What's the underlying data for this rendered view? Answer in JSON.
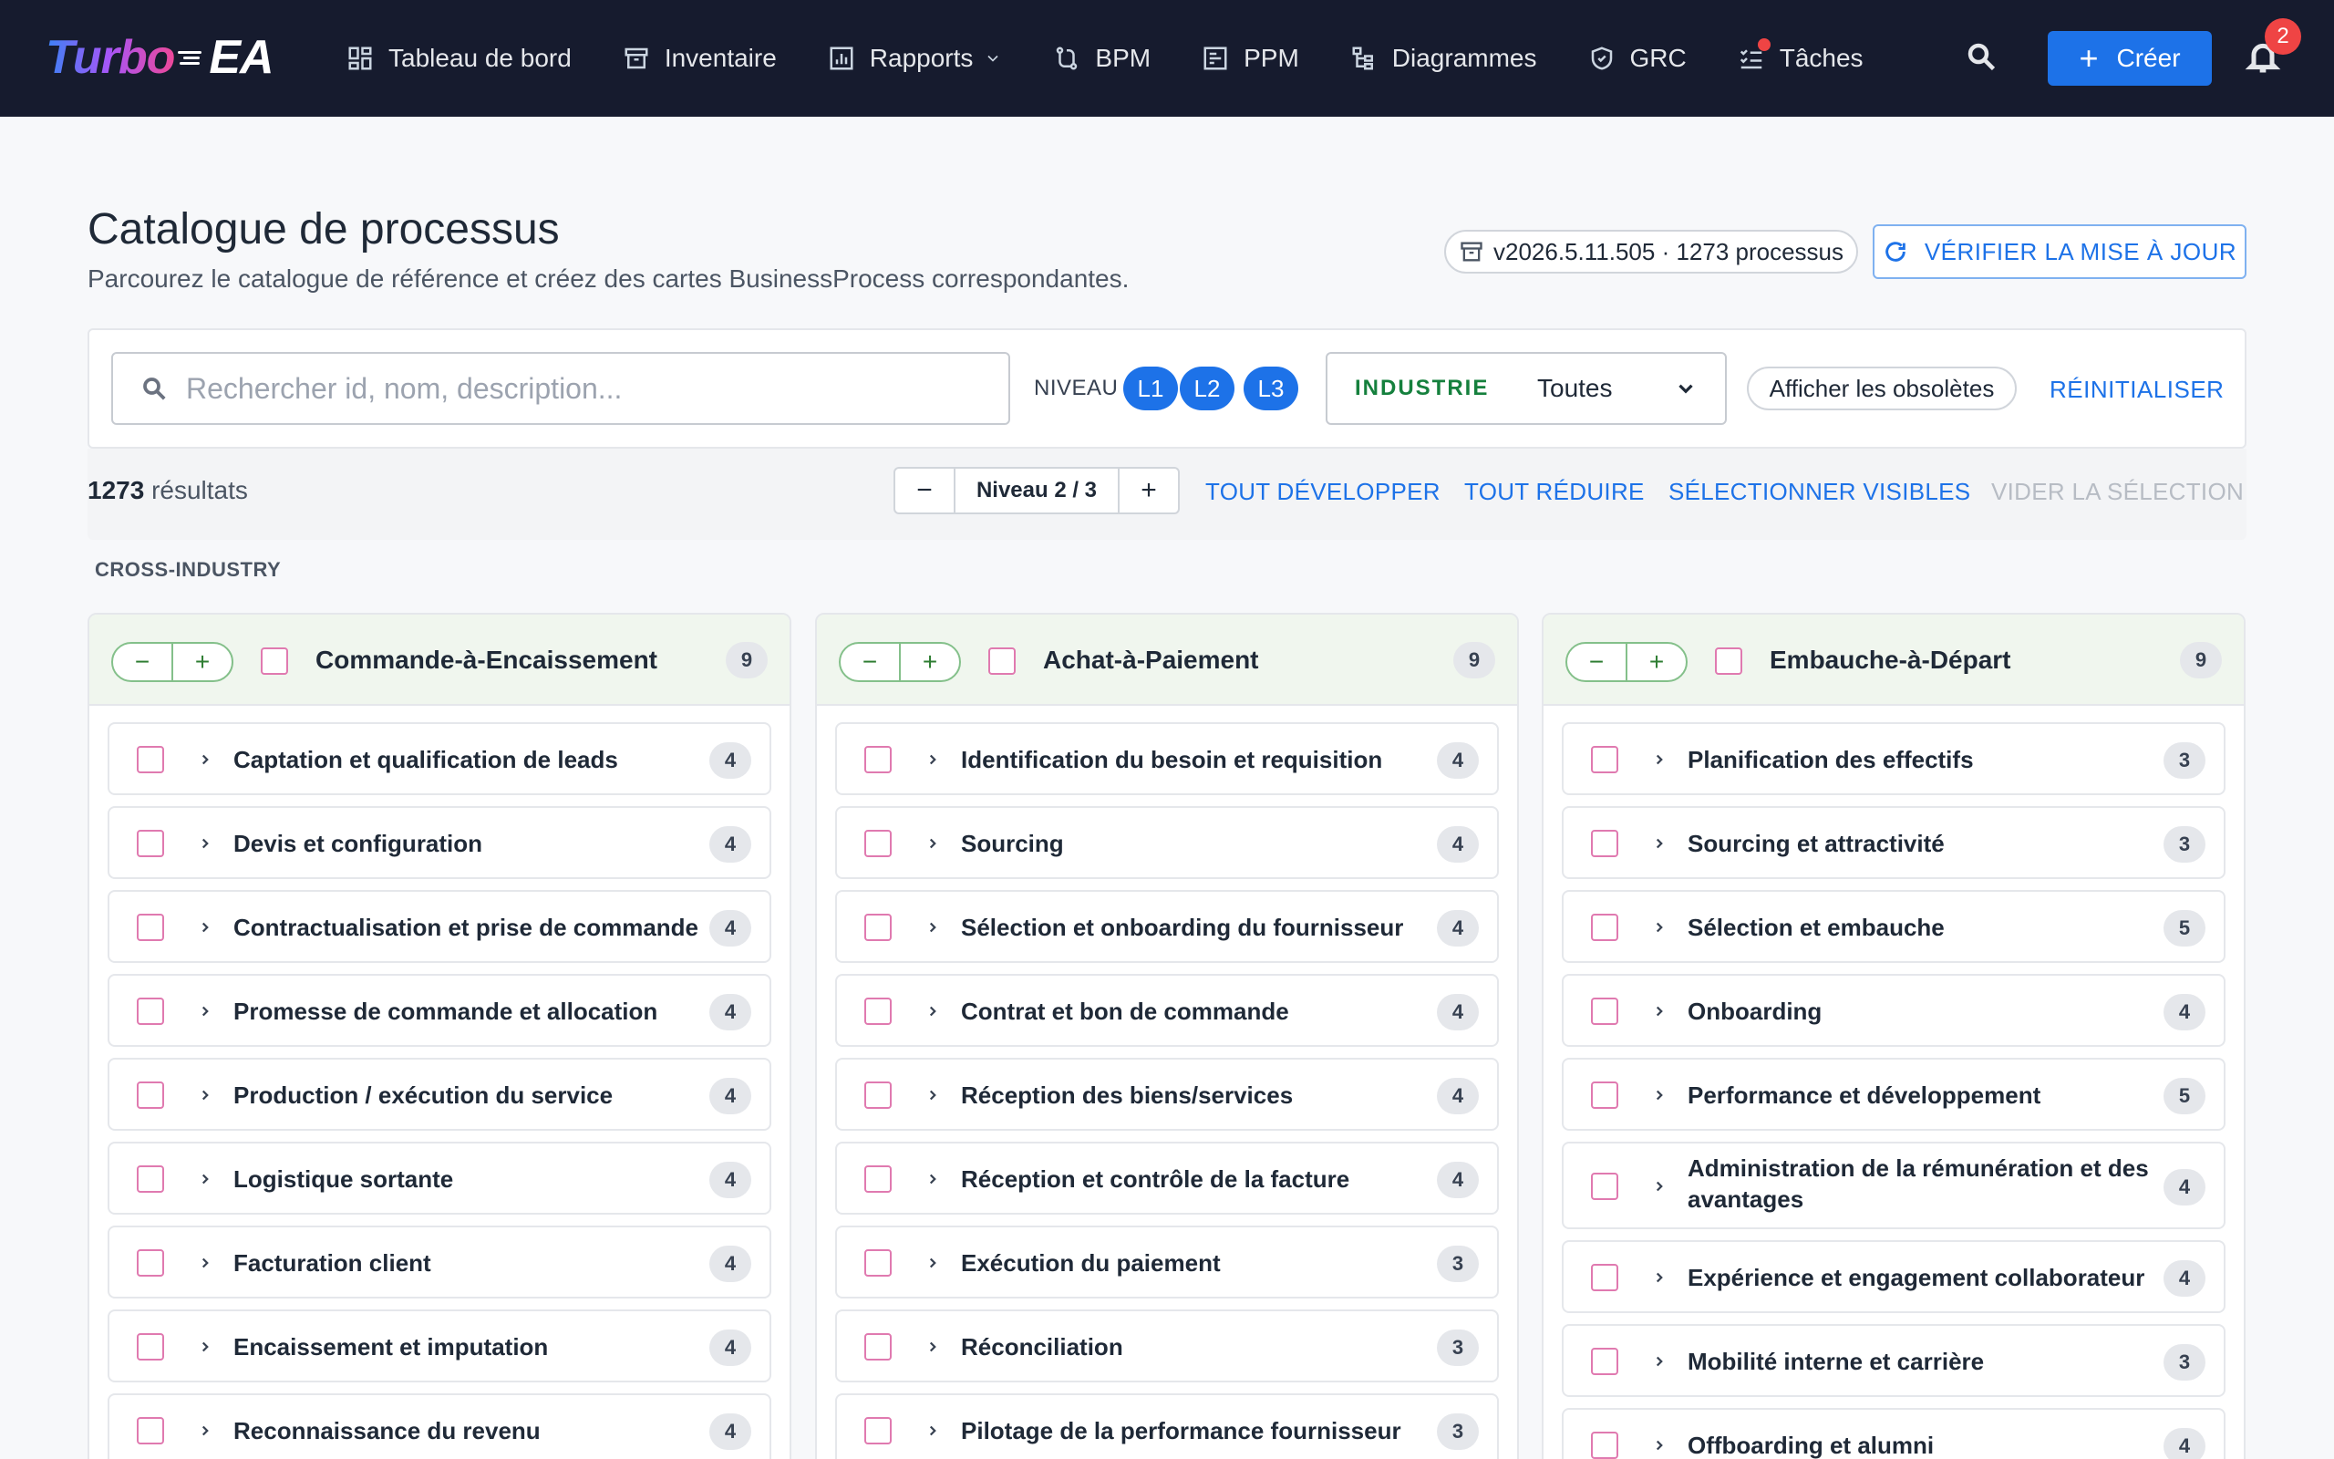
{
  "nav": {
    "logo_turbo": "Turbo",
    "logo_ea": "EA",
    "items": [
      {
        "label": "Tableau de bord",
        "icon": "dashboard-icon"
      },
      {
        "label": "Inventaire",
        "icon": "archive-icon"
      },
      {
        "label": "Rapports",
        "icon": "report-icon"
      },
      {
        "label": "BPM",
        "icon": "bpm-icon"
      },
      {
        "label": "PPM",
        "icon": "ppm-icon"
      },
      {
        "label": "Diagrammes",
        "icon": "diagram-icon"
      },
      {
        "label": "GRC",
        "icon": "shield-icon"
      },
      {
        "label": "Tâches",
        "icon": "tasks-icon"
      }
    ],
    "create_label": "Créer",
    "notification_count": "2"
  },
  "header": {
    "title": "Catalogue de processus",
    "subtitle": "Parcourez le catalogue de référence et créez des cartes BusinessProcess correspondantes.",
    "version": "v2026.5.11.505 · 1273 processus",
    "update_label": "VÉRIFIER LA MISE À JOUR"
  },
  "filters": {
    "search_placeholder": "Rechercher id, nom, description...",
    "niveau_label": "NIVEAU",
    "levels": [
      "L1",
      "L2",
      "L3"
    ],
    "industry_label": "INDUSTRIE",
    "industry_value": "Toutes",
    "obsolete_label": "Afficher les obsolètes",
    "reset_label": "RÉINITIALISER"
  },
  "results": {
    "count": "1273",
    "count_suffix": " résultats",
    "stepper_minus": "−",
    "stepper_label": "Niveau 2 / 3",
    "stepper_plus": "+",
    "expand_all": "TOUT DÉVELOPPER",
    "collapse_all": "TOUT RÉDUIRE",
    "select_visible": "SÉLECTIONNER VISIBLES",
    "clear_selection": "VIDER LA SÉLECTION"
  },
  "section": {
    "label": "CROSS-INDUSTRY"
  },
  "columns": [
    {
      "title": "Commande-à-Encaissement",
      "count": "9",
      "items": [
        {
          "label": "Captation et qualification de leads",
          "count": "4"
        },
        {
          "label": "Devis et configuration",
          "count": "4"
        },
        {
          "label": "Contractualisation et prise de commande",
          "count": "4"
        },
        {
          "label": "Promesse de commande et allocation",
          "count": "4"
        },
        {
          "label": "Production / exécution du service",
          "count": "4"
        },
        {
          "label": "Logistique sortante",
          "count": "4"
        },
        {
          "label": "Facturation client",
          "count": "4"
        },
        {
          "label": "Encaissement et imputation",
          "count": "4"
        },
        {
          "label": "Reconnaissance du revenu",
          "count": "4"
        }
      ]
    },
    {
      "title": "Achat-à-Paiement",
      "count": "9",
      "items": [
        {
          "label": "Identification du besoin et requisition",
          "count": "4"
        },
        {
          "label": "Sourcing",
          "count": "4"
        },
        {
          "label": "Sélection et onboarding du fournisseur",
          "count": "4"
        },
        {
          "label": "Contrat et bon de commande",
          "count": "4"
        },
        {
          "label": "Réception des biens/services",
          "count": "4"
        },
        {
          "label": "Réception et contrôle de la facture",
          "count": "4"
        },
        {
          "label": "Exécution du paiement",
          "count": "3"
        },
        {
          "label": "Réconciliation",
          "count": "3"
        },
        {
          "label": "Pilotage de la performance fournisseur",
          "count": "3"
        }
      ]
    },
    {
      "title": "Embauche-à-Départ",
      "count": "9",
      "items": [
        {
          "label": "Planification des effectifs",
          "count": "3"
        },
        {
          "label": "Sourcing et attractivité",
          "count": "3"
        },
        {
          "label": "Sélection et embauche",
          "count": "5"
        },
        {
          "label": "Onboarding",
          "count": "4"
        },
        {
          "label": "Performance et développement",
          "count": "5"
        },
        {
          "label": "Administration de la rémunération et des avantages",
          "count": "4"
        },
        {
          "label": "Expérience et engagement collaborateur",
          "count": "4"
        },
        {
          "label": "Mobilité interne et carrière",
          "count": "3"
        },
        {
          "label": "Offboarding et alumni",
          "count": "4"
        }
      ]
    }
  ],
  "colors": {
    "nav_bg": "#161b2e",
    "accent": "#1d72e8",
    "industry_label": "#15803d",
    "checkbox_border": "#e07ab0",
    "column_header_bg": "#f0f6ee",
    "notification": "#ef4444"
  }
}
